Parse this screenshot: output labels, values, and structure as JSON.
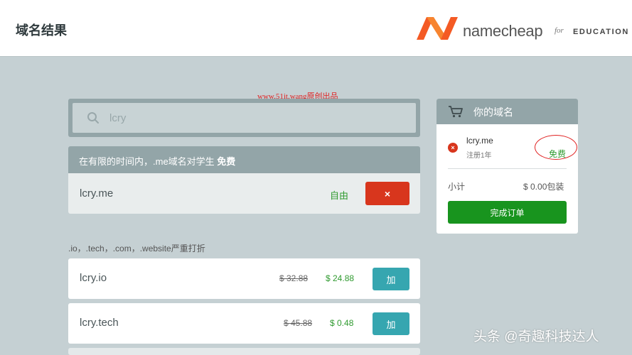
{
  "header": {
    "title": "域名结果",
    "brand": {
      "name": "namecheap",
      "for": "for",
      "edu": "EDUCATION",
      "colors": {
        "mark": "#f45a24",
        "text": "#555555"
      }
    }
  },
  "watermarks": {
    "top": "www.51it.wang原创出品",
    "bottom": "头条 @奇趣科技达人"
  },
  "search": {
    "icon": "search-icon",
    "value": "lcry"
  },
  "promo": {
    "headline_text": "在有限的时间内，.me域名对学生 ",
    "headline_bold": "免费",
    "domain": "lcry.me",
    "status": "自由",
    "remove_label": "×"
  },
  "discount_note": ".io，.tech，.com，.website严重打折",
  "results": [
    {
      "domain": "lcry.io",
      "old_price": "$ 32.88",
      "new_price": "$ 24.88",
      "add_label": "加"
    },
    {
      "domain": "lcry.tech",
      "old_price": "$ 45.88",
      "new_price": "$ 0.48",
      "add_label": "加"
    }
  ],
  "cart": {
    "title": "你的域名",
    "icon": "cart-icon",
    "item": {
      "remove_label": "×",
      "domain": "lcry.me",
      "term": "注册1年",
      "price": "免费"
    },
    "subtotal_label": "小计",
    "subtotal_value": "$ 0.00包装",
    "checkout_label": "完成订单"
  },
  "colors": {
    "background": "#c5d0d3",
    "panel_header": "#93a5a8",
    "danger": "#d8361d",
    "add": "#36a6b0",
    "success": "#18941e",
    "price_green": "#2f9a2f"
  }
}
